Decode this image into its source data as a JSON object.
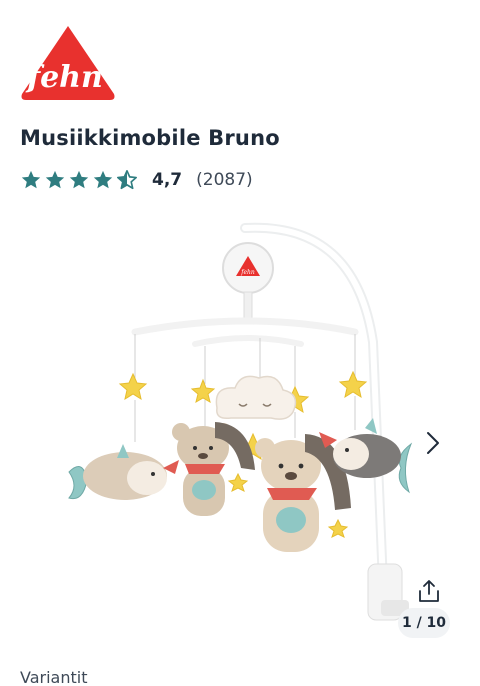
{
  "brand": {
    "logo_text": "fehn",
    "logo_mark": "®",
    "color": "#e8312e"
  },
  "product": {
    "title": "Musiikkimobile Bruno"
  },
  "rating": {
    "value": "4,7",
    "count": "(2087)",
    "stars": 4.5,
    "star_color": "#2f7d80"
  },
  "gallery": {
    "counter": "1 / 10",
    "image_icon": "baby-mobile-image",
    "share_icon": "share-icon",
    "next_icon": "chevron-right-icon"
  },
  "variants": {
    "label": "Variantit"
  }
}
